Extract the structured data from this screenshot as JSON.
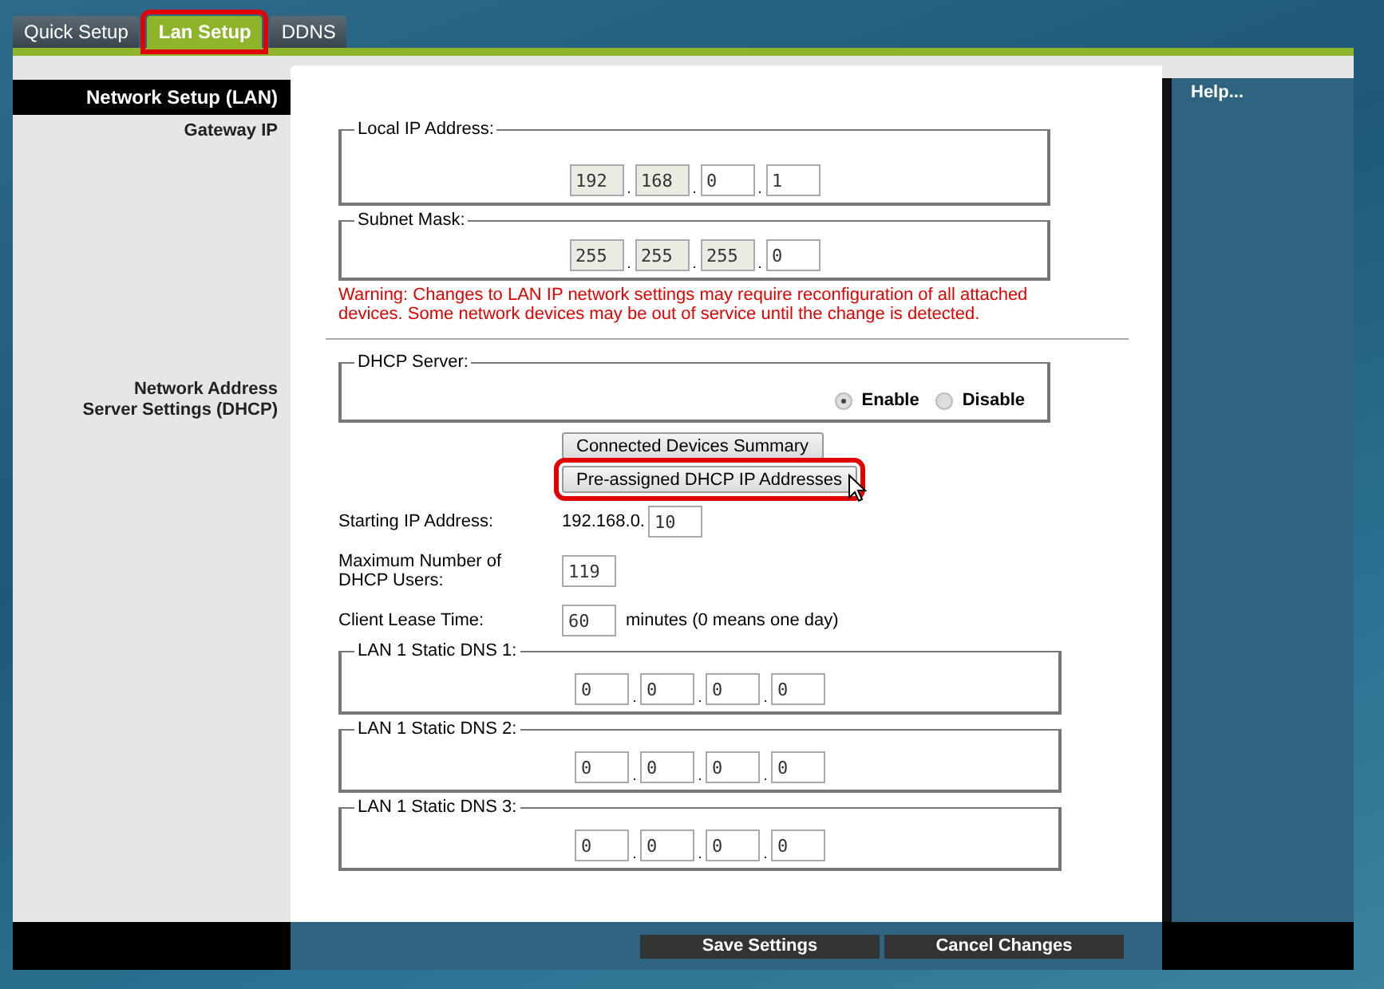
{
  "tabs": [
    {
      "label": "Quick Setup",
      "selected": false,
      "highlighted": false
    },
    {
      "label": "Lan Setup",
      "selected": true,
      "highlighted": true
    },
    {
      "label": "DDNS",
      "selected": false,
      "highlighted": false
    }
  ],
  "sidebar": {
    "title": "Network Setup (LAN)",
    "sections": [
      {
        "lines": [
          "Gateway IP"
        ],
        "kind": "gateway"
      },
      {
        "lines": [
          "Network Address",
          "Server Settings (DHCP)"
        ],
        "kind": "dhcp"
      }
    ]
  },
  "help": "Help...",
  "octet_separator": ".",
  "gateway": [
    {
      "legend": "Local IP Address:",
      "octets": [
        {
          "value": "192",
          "disabled": true
        },
        {
          "value": "168",
          "disabled": true
        },
        {
          "value": "0",
          "disabled": false
        },
        {
          "value": "1",
          "disabled": false
        }
      ]
    },
    {
      "legend": "Subnet Mask:",
      "octets": [
        {
          "value": "255",
          "disabled": true
        },
        {
          "value": "255",
          "disabled": true
        },
        {
          "value": "255",
          "disabled": true
        },
        {
          "value": "0",
          "disabled": false
        }
      ]
    }
  ],
  "warning": "Warning: Changes to LAN IP network settings may require reconfiguration of all attached devices. Some network devices may be out of service until the change is detected.",
  "dhcp_server": {
    "legend": "DHCP Server:",
    "options": [
      {
        "label": "Enable",
        "selected": true
      },
      {
        "label": "Disable",
        "selected": false
      }
    ]
  },
  "buttons": [
    {
      "label": "Connected Devices Summary",
      "highlighted": false,
      "cursor": false
    },
    {
      "label": "Pre-assigned DHCP IP Addresses",
      "highlighted": true,
      "cursor": true
    }
  ],
  "fields": [
    {
      "label": "Starting IP Address:",
      "prefix": "192.168.0.",
      "value": "10"
    },
    {
      "label": "Maximum Number of DHCP Users:",
      "value": "119"
    },
    {
      "label": "Client Lease Time:",
      "value": "60",
      "suffix": "minutes (0 means one day)"
    }
  ],
  "dns": [
    {
      "legend": "LAN 1 Static DNS 1:",
      "octets": [
        {
          "value": "0",
          "disabled": false
        },
        {
          "value": "0",
          "disabled": false
        },
        {
          "value": "0",
          "disabled": false
        },
        {
          "value": "0",
          "disabled": false
        }
      ]
    },
    {
      "legend": "LAN 1 Static DNS 2:",
      "octets": [
        {
          "value": "0",
          "disabled": false
        },
        {
          "value": "0",
          "disabled": false
        },
        {
          "value": "0",
          "disabled": false
        },
        {
          "value": "0",
          "disabled": false
        }
      ]
    },
    {
      "legend": "LAN 1 Static DNS 3:",
      "octets": [
        {
          "value": "0",
          "disabled": false
        },
        {
          "value": "0",
          "disabled": false
        },
        {
          "value": "0",
          "disabled": false
        },
        {
          "value": "0",
          "disabled": false
        }
      ]
    }
  ],
  "footer_buttons": [
    "Save Settings",
    "Cancel Changes"
  ]
}
